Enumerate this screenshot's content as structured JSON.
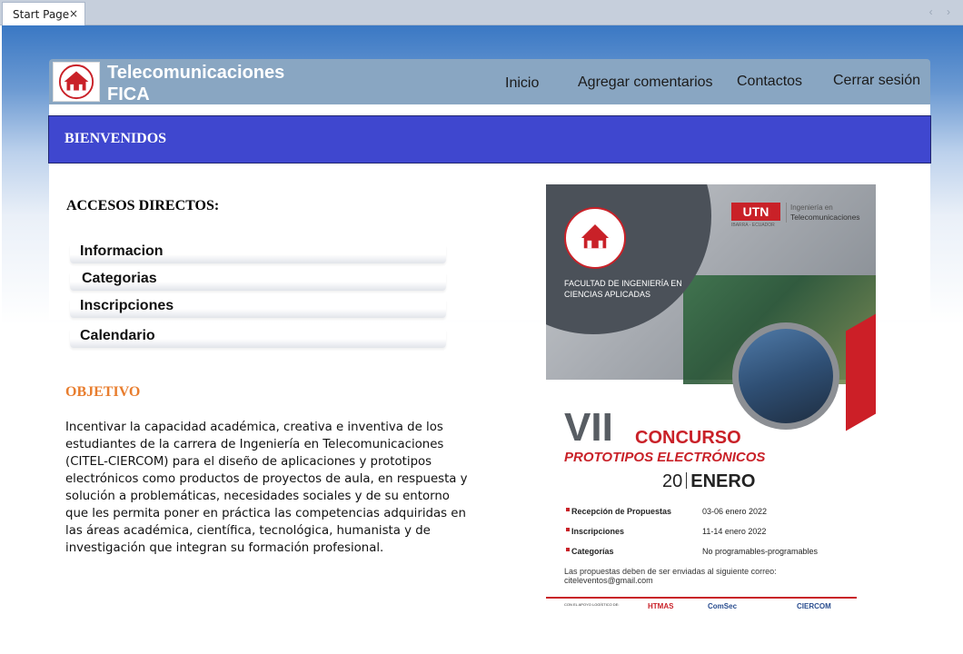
{
  "tab": {
    "title": "Start Page",
    "close": "×",
    "nav": "‹ ›"
  },
  "header": {
    "title_line1": "Telecomunicaciones",
    "title_line2": "FICA",
    "nav": [
      "Inicio",
      "Agregar comentarios",
      "Contactos",
      "Cerrar sesión"
    ]
  },
  "welcome": "BIENVENIDOS",
  "accesos": {
    "title": "ACCESOS DIRECTOS:",
    "links": [
      "Informacion",
      "Categorias",
      "Inscripciones",
      "Calendario"
    ]
  },
  "objetivo": {
    "title": "OBJETIVO",
    "text": "Incentivar la capacidad académica, creativa e inventiva de los estudiantes de la carrera de Ingeniería en Telecomunicaciones (CITEL-CIERCOM) para el diseño de aplicaciones y prototipos electrónicos como productos de proyectos de aula, en respuesta y solución a problemáticas, necesidades sociales y de su entorno que les permita poner en práctica las competencias adquiridas en las áreas académica, científica, tecnológica, humanista y de investigación que integran su formación profesional."
  },
  "poster": {
    "utn": "UTN",
    "utn_sub": "IBARRA - ECUADOR",
    "ing_line1": "Ingeniería en",
    "ing_line2": "Telecomunicaciones",
    "facultad": "FACULTAD DE INGENIERÍA EN CIENCIAS APLICADAS",
    "vii": "VII",
    "concurso": "CONCURSO",
    "prototipos": "PROTOTIPOS ELECTRÓNICOS",
    "date_day": "20",
    "date_month": "ENERO",
    "rows": [
      {
        "label": "Recepción de Propuestas",
        "value": "03-06 enero 2022"
      },
      {
        "label": "Inscripciones",
        "value": "11-14 enero 2022"
      },
      {
        "label": "Categorías",
        "value": "No programables-programables"
      }
    ],
    "note": "Las propuestas deben de ser enviadas al siguiente correo: citeleventos@gmail.com",
    "footer": "CON EL APOYO LOGÍSTICO DE:",
    "sponsors": [
      "HTMAS",
      "ComSec",
      "CIERCOM"
    ]
  },
  "colors": {
    "accent_blue": "#3f47cf",
    "header": "#89a6c2",
    "objetivo": "#e87d2e",
    "poster_red": "#c92128"
  }
}
